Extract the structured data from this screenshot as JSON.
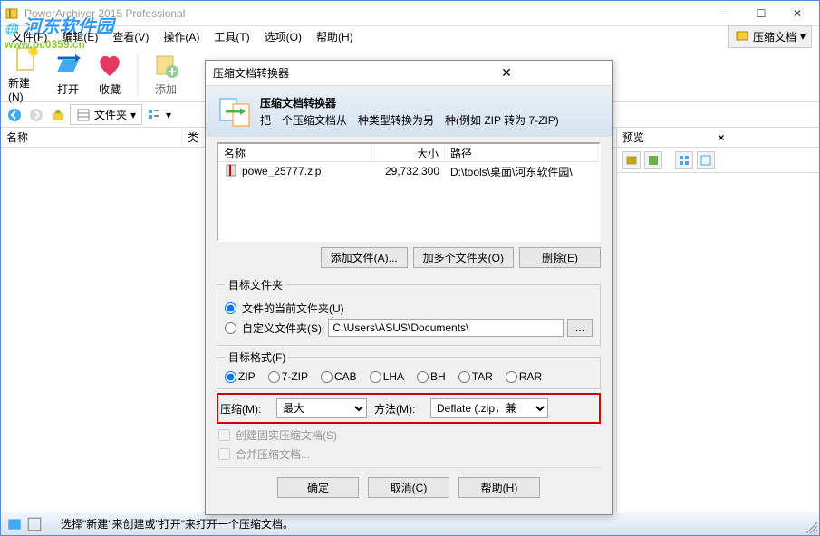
{
  "main": {
    "title": "PowerArchiver 2015 Professional",
    "menus": [
      "文件(F)",
      "编辑(E)",
      "查看(V)",
      "操作(A)",
      "工具(T)",
      "选项(O)",
      "帮助(H)"
    ],
    "right_menu_btn": "压缩文档",
    "toolbar": [
      {
        "label": "新建(N)"
      },
      {
        "label": "打开"
      },
      {
        "label": "收藏"
      },
      {
        "label": "添加"
      }
    ],
    "nav_folder_label": "文件夹",
    "list_cols": [
      "名称",
      "类"
    ],
    "preview_title": "预览",
    "status": "选择\"新建\"来创建或\"打开\"来打开一个压缩文档。"
  },
  "dialog": {
    "title": "压缩文档转换器",
    "header_title": "压缩文档转换器",
    "header_desc": "把一个压缩文档从一种类型转换为另一种(例如 ZIP 转为 7-ZIP)",
    "list_cols": {
      "name": "名称",
      "size": "大小",
      "path": "路径"
    },
    "row": {
      "name": "powe_25777.zip",
      "size": "29,732,300",
      "path": "D:\\tools\\桌面\\河东软件园\\"
    },
    "btn_addfile": "添加文件(A)...",
    "btn_addfolders": "加多个文件夹(O)",
    "btn_remove": "删除(E)",
    "target_group": "目标文件夹",
    "radio_current": "文件的当前文件夹(U)",
    "radio_custom": "自定义文件夹(S):",
    "custom_path": "C:\\Users\\ASUS\\Documents\\",
    "browse": "...",
    "format_group": "目标格式(F)",
    "formats": [
      "ZIP",
      "7-ZIP",
      "CAB",
      "LHA",
      "BH",
      "TAR",
      "RAR"
    ],
    "compress_label": "压缩(M):",
    "compress_value": "最大",
    "method_label": "方法(M):",
    "method_value": "Deflate (.zip，兼",
    "chk_solid": "创建固实压缩文档(S)",
    "chk_merge": "合并压缩文档...",
    "btn_ok": "确定",
    "btn_cancel": "取消(C)",
    "btn_help": "帮助(H)"
  }
}
